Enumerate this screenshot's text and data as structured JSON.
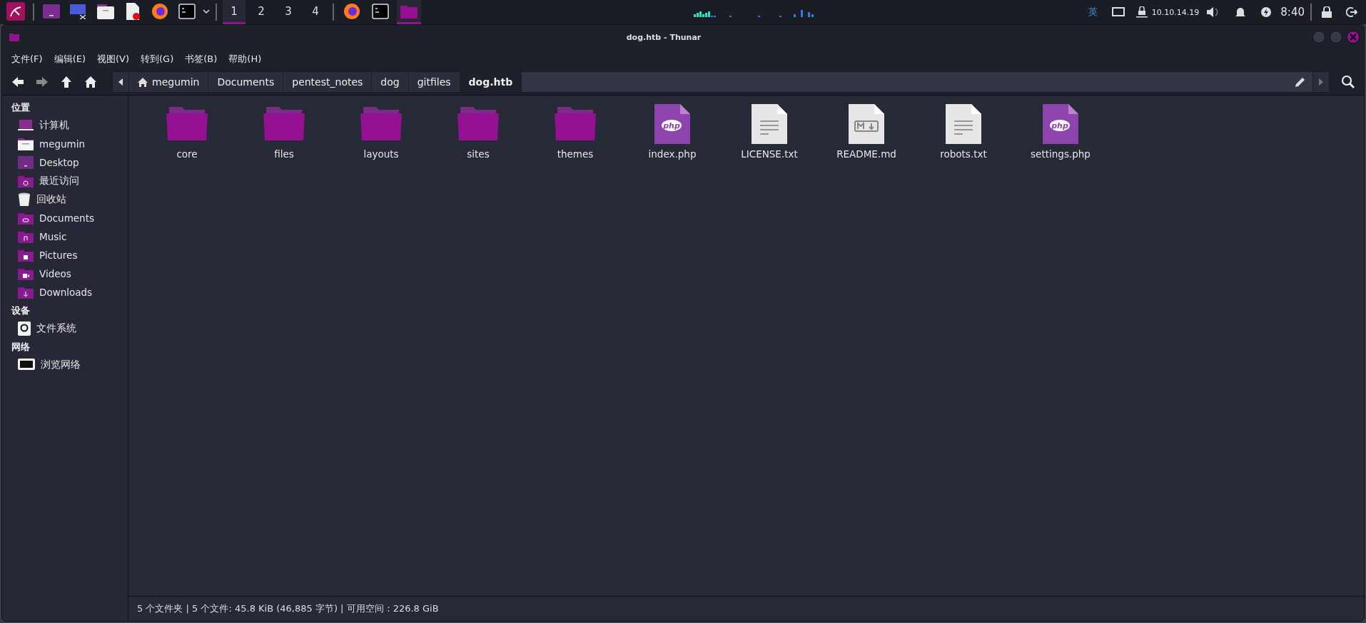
{
  "taskbar": {
    "launchers": [
      {
        "kind": "menu"
      },
      {
        "kind": "desktop"
      },
      {
        "kind": "screen"
      },
      {
        "kind": "files"
      },
      {
        "kind": "editor"
      },
      {
        "kind": "firefox"
      },
      {
        "kind": "terminal"
      }
    ],
    "workspaces": [
      {
        "label": "1",
        "selected": true
      },
      {
        "label": "2",
        "selected": false
      },
      {
        "label": "3",
        "selected": false
      },
      {
        "label": "4",
        "selected": false
      }
    ],
    "tasks": [
      {
        "kind": "firefox",
        "active": false
      },
      {
        "kind": "terminal",
        "active": false
      },
      {
        "kind": "folder",
        "active": true
      }
    ],
    "input_method": "英",
    "ip": "10.10.14.19",
    "time": "8:40"
  },
  "window": {
    "title": "dog.htb - Thunar"
  },
  "menu": [
    "文件(F)",
    "编辑(E)",
    "视图(V)",
    "转到(G)",
    "书签(B)",
    "帮助(H)"
  ],
  "path": [
    {
      "label": "megumin",
      "kind": "home",
      "selected": false
    },
    {
      "label": "Documents",
      "kind": "dir",
      "selected": false
    },
    {
      "label": "pentest_notes",
      "kind": "dir",
      "selected": false
    },
    {
      "label": "dog",
      "kind": "dir",
      "selected": false
    },
    {
      "label": "gitfiles",
      "kind": "dir",
      "selected": false
    },
    {
      "label": "dog.htb",
      "kind": "dir",
      "selected": true
    }
  ],
  "sidebar": [
    {
      "heading": "位置",
      "items": [
        {
          "label": "计算机",
          "kind": "computer"
        },
        {
          "label": "megumin",
          "kind": "home"
        },
        {
          "label": "Desktop",
          "kind": "desktop"
        },
        {
          "label": "最近访问",
          "kind": "recent"
        },
        {
          "label": "回收站",
          "kind": "trash"
        },
        {
          "label": "Documents",
          "kind": "documents"
        },
        {
          "label": "Music",
          "kind": "music"
        },
        {
          "label": "Pictures",
          "kind": "pictures"
        },
        {
          "label": "Videos",
          "kind": "videos"
        },
        {
          "label": "Downloads",
          "kind": "downloads"
        }
      ]
    },
    {
      "heading": "设备",
      "items": [
        {
          "label": "文件系统",
          "kind": "drive"
        }
      ]
    },
    {
      "heading": "网络",
      "items": [
        {
          "label": "浏览网络",
          "kind": "network"
        }
      ]
    }
  ],
  "files": [
    {
      "name": "core",
      "kind": "folder"
    },
    {
      "name": "files",
      "kind": "folder"
    },
    {
      "name": "layouts",
      "kind": "folder"
    },
    {
      "name": "sites",
      "kind": "folder"
    },
    {
      "name": "themes",
      "kind": "folder"
    },
    {
      "name": "index.php",
      "kind": "php"
    },
    {
      "name": "LICENSE.txt",
      "kind": "text"
    },
    {
      "name": "README.md",
      "kind": "markdown"
    },
    {
      "name": "robots.txt",
      "kind": "text"
    },
    {
      "name": "settings.php",
      "kind": "php"
    }
  ],
  "status_bar": "5 个文件夹 | 5 个文件: 45.8 KiB (46,885 字节) | 可用空间：226.8 GiB"
}
